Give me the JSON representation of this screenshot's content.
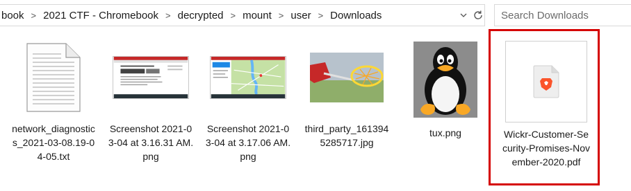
{
  "breadcrumb": {
    "items": [
      "book",
      "2021 CTF - Chromebook",
      "decrypted",
      "mount",
      "user",
      "Downloads"
    ]
  },
  "search": {
    "placeholder": "Search Downloads"
  },
  "files": [
    {
      "name": "network_diagnostics_2021-03-08.19-04-05.txt",
      "icon": "text-document-icon"
    },
    {
      "name": "Screenshot 2021-03-04 at 3.16.31 AM.png",
      "icon": "screenshot-thumbnail"
    },
    {
      "name": "Screenshot 2021-03-04 at 3.17.06 AM.png",
      "icon": "map-screenshot-thumbnail"
    },
    {
      "name": "third_party_1613945285717.jpg",
      "icon": "lacrosse-stick-thumbnail"
    },
    {
      "name": "tux.png",
      "icon": "tux-penguin-thumbnail"
    },
    {
      "name": "Wickr-Customer-Security-Promises-November-2020.pdf",
      "icon": "brave-pdf-icon"
    }
  ],
  "colors": {
    "selection_outline": "#d50000",
    "brave_orange": "#fb542b"
  }
}
